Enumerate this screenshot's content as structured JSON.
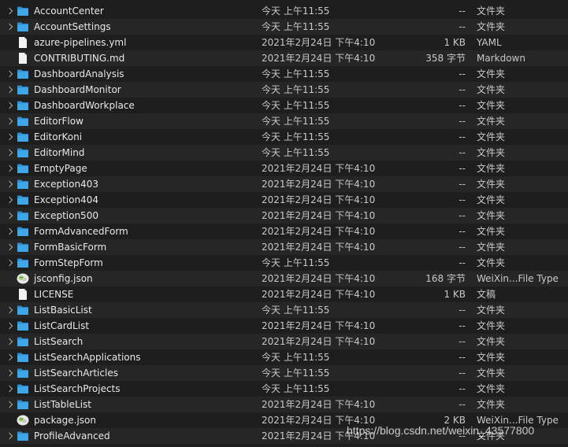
{
  "colors": {
    "folder": "#3fa7e8",
    "folder_tab": "#2f8ed1",
    "background": "#1e1e1e",
    "row_alt": "#262626"
  },
  "files": [
    {
      "name": "AccountCenter",
      "date": "今天 上午11:55",
      "size": "--",
      "kind": "文件夹",
      "icon": "folder-icon",
      "expandable": true
    },
    {
      "name": "AccountSettings",
      "date": "今天 上午11:55",
      "size": "--",
      "kind": "文件夹",
      "icon": "folder-icon",
      "expandable": true
    },
    {
      "name": "azure-pipelines.yml",
      "date": "2021年2月24日 下午4:10",
      "size": "1 KB",
      "kind": "YAML",
      "icon": "document-icon",
      "expandable": false
    },
    {
      "name": "CONTRIBUTING.md",
      "date": "2021年2月24日 下午4:10",
      "size": "358 字节",
      "kind": "Markdown",
      "icon": "document-icon",
      "expandable": false
    },
    {
      "name": "DashboardAnalysis",
      "date": "今天 上午11:55",
      "size": "--",
      "kind": "文件夹",
      "icon": "folder-icon",
      "expandable": true
    },
    {
      "name": "DashboardMonitor",
      "date": "今天 上午11:55",
      "size": "--",
      "kind": "文件夹",
      "icon": "folder-icon",
      "expandable": true
    },
    {
      "name": "DashboardWorkplace",
      "date": "今天 上午11:55",
      "size": "--",
      "kind": "文件夹",
      "icon": "folder-icon",
      "expandable": true
    },
    {
      "name": "EditorFlow",
      "date": "今天 上午11:55",
      "size": "--",
      "kind": "文件夹",
      "icon": "folder-icon",
      "expandable": true
    },
    {
      "name": "EditorKoni",
      "date": "今天 上午11:55",
      "size": "--",
      "kind": "文件夹",
      "icon": "folder-icon",
      "expandable": true
    },
    {
      "name": "EditorMind",
      "date": "今天 上午11:55",
      "size": "--",
      "kind": "文件夹",
      "icon": "folder-icon",
      "expandable": true
    },
    {
      "name": "EmptyPage",
      "date": "2021年2月24日 下午4:10",
      "size": "--",
      "kind": "文件夹",
      "icon": "folder-icon",
      "expandable": true
    },
    {
      "name": "Exception403",
      "date": "2021年2月24日 下午4:10",
      "size": "--",
      "kind": "文件夹",
      "icon": "folder-icon",
      "expandable": true
    },
    {
      "name": "Exception404",
      "date": "2021年2月24日 下午4:10",
      "size": "--",
      "kind": "文件夹",
      "icon": "folder-icon",
      "expandable": true
    },
    {
      "name": "Exception500",
      "date": "2021年2月24日 下午4:10",
      "size": "--",
      "kind": "文件夹",
      "icon": "folder-icon",
      "expandable": true
    },
    {
      "name": "FormAdvancedForm",
      "date": "2021年2月24日 下午4:10",
      "size": "--",
      "kind": "文件夹",
      "icon": "folder-icon",
      "expandable": true
    },
    {
      "name": "FormBasicForm",
      "date": "2021年2月24日 下午4:10",
      "size": "--",
      "kind": "文件夹",
      "icon": "folder-icon",
      "expandable": true
    },
    {
      "name": "FormStepForm",
      "date": "今天 上午11:55",
      "size": "--",
      "kind": "文件夹",
      "icon": "folder-icon",
      "expandable": true
    },
    {
      "name": "jsconfig.json",
      "date": "2021年2月24日 下午4:10",
      "size": "168 字节",
      "kind": "WeiXin...File Type",
      "icon": "wechat-icon",
      "expandable": false
    },
    {
      "name": "LICENSE",
      "date": "2021年2月24日 下午4:10",
      "size": "1 KB",
      "kind": "文稿",
      "icon": "document-icon",
      "expandable": false
    },
    {
      "name": "ListBasicList",
      "date": "今天 上午11:55",
      "size": "--",
      "kind": "文件夹",
      "icon": "folder-icon",
      "expandable": true
    },
    {
      "name": "ListCardList",
      "date": "2021年2月24日 下午4:10",
      "size": "--",
      "kind": "文件夹",
      "icon": "folder-icon",
      "expandable": true
    },
    {
      "name": "ListSearch",
      "date": "2021年2月24日 下午4:10",
      "size": "--",
      "kind": "文件夹",
      "icon": "folder-icon",
      "expandable": true
    },
    {
      "name": "ListSearchApplications",
      "date": "今天 上午11:55",
      "size": "--",
      "kind": "文件夹",
      "icon": "folder-icon",
      "expandable": true
    },
    {
      "name": "ListSearchArticles",
      "date": "今天 上午11:55",
      "size": "--",
      "kind": "文件夹",
      "icon": "folder-icon",
      "expandable": true
    },
    {
      "name": "ListSearchProjects",
      "date": "今天 上午11:55",
      "size": "--",
      "kind": "文件夹",
      "icon": "folder-icon",
      "expandable": true
    },
    {
      "name": "ListTableList",
      "date": "2021年2月24日 下午4:10",
      "size": "--",
      "kind": "文件夹",
      "icon": "folder-icon",
      "expandable": true
    },
    {
      "name": "package.json",
      "date": "2021年2月24日 下午4:10",
      "size": "2 KB",
      "kind": "WeiXin...File Type",
      "icon": "wechat-icon",
      "expandable": false
    },
    {
      "name": "ProfileAdvanced",
      "date": "2021年2月24日 下午4:10",
      "size": "--",
      "kind": "文件夹",
      "icon": "folder-icon",
      "expandable": true
    }
  ],
  "watermark": "https://blog.csdn.net/weixin_43577800"
}
